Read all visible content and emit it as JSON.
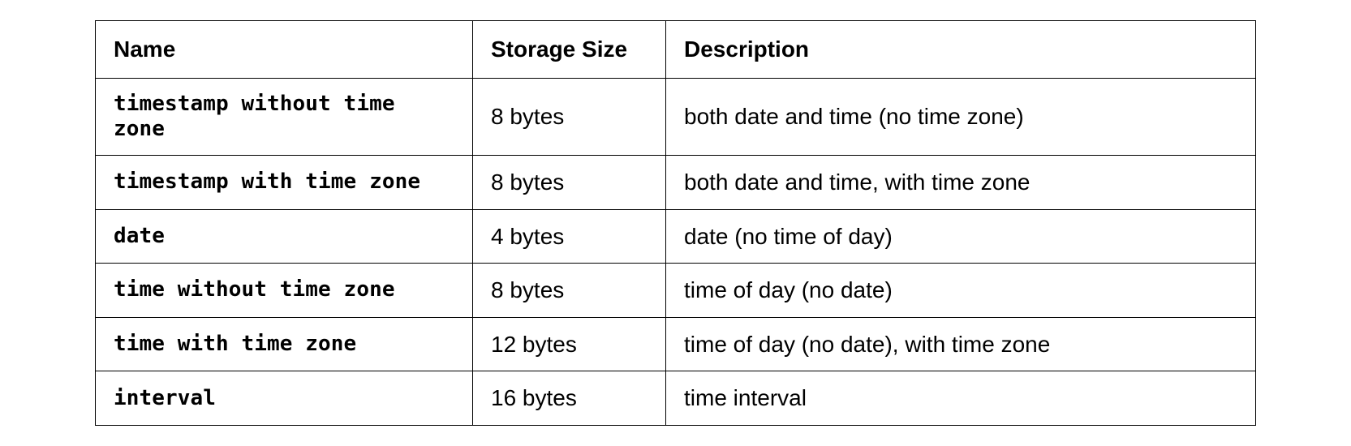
{
  "table": {
    "headers": {
      "name": "Name",
      "storage": "Storage Size",
      "description": "Description"
    },
    "rows": [
      {
        "name": "timestamp without time zone",
        "storage": "8 bytes",
        "description": "both date and time (no time zone)"
      },
      {
        "name": "timestamp with time zone",
        "storage": "8 bytes",
        "description": "both date and time, with time zone"
      },
      {
        "name": "date",
        "storage": "4 bytes",
        "description": "date (no time of day)"
      },
      {
        "name": "time without time zone",
        "storage": "8 bytes",
        "description": "time of day (no date)"
      },
      {
        "name": "time with time zone",
        "storage": "12 bytes",
        "description": "time of day (no date), with time zone"
      },
      {
        "name": "interval",
        "storage": "16 bytes",
        "description": "time interval"
      }
    ]
  }
}
